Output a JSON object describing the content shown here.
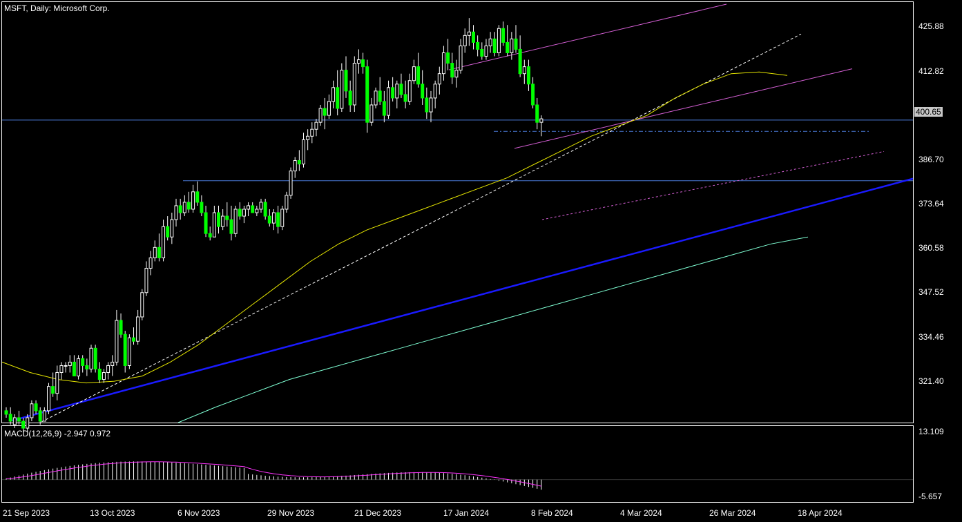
{
  "header": {
    "title": "MSFT, Daily:  Microsoft Corp."
  },
  "macd": {
    "label": "MACD(12,26,9) -2.947 0.972",
    "ymax": "13.109",
    "ymin": "-5.657"
  },
  "price_axis": [
    "425.88",
    "412.82",
    "386.70",
    "373.64",
    "360.58",
    "347.52",
    "334.46",
    "321.40"
  ],
  "current_price": "400.65",
  "date_axis": [
    "21 Sep 2023",
    "13 Oct 2023",
    "6 Nov 2023",
    "29 Nov 2023",
    "21 Dec 2023",
    "17 Jan 2024",
    "8 Feb 2024",
    "4 Mar 2024",
    "26 Mar 2024",
    "18 Apr 2024"
  ],
  "colors": {
    "background": "#000000",
    "bull": "#ffffff",
    "bear": "#00ff00",
    "wick": "#ffffff",
    "ma_short": "#e6e600",
    "ma_long": "#7fffd4",
    "macd_hist": "#ffffff",
    "macd_signal": "#ff33ff",
    "trend_blue": "#1a1aff",
    "channel": "#d45fd4",
    "hline": "#4a7bd9",
    "frame": "#ffffff"
  },
  "chart_data": {
    "type": "candlestick",
    "symbol": "MSFT",
    "timeframe": "Daily",
    "ylim": [
      313.6,
      434.6
    ],
    "last_price": 400.65,
    "candles": [
      [
        317,
        318,
        315,
        316
      ],
      [
        316,
        318,
        313,
        314
      ],
      [
        313,
        316,
        312,
        315
      ],
      [
        315,
        317,
        313,
        314
      ],
      [
        314,
        315,
        311,
        312
      ],
      [
        312,
        316,
        311,
        315
      ],
      [
        315,
        320,
        314,
        319
      ],
      [
        319,
        320,
        316,
        317
      ],
      [
        317,
        318,
        313,
        314
      ],
      [
        314,
        318,
        314,
        317
      ],
      [
        317,
        325,
        316,
        324
      ],
      [
        324,
        328,
        321,
        322
      ],
      [
        322,
        330,
        320,
        328
      ],
      [
        328,
        331,
        326,
        330
      ],
      [
        330,
        331,
        328,
        330
      ],
      [
        330,
        333,
        328,
        331
      ],
      [
        331,
        333,
        327,
        327
      ],
      [
        327,
        333,
        326,
        332
      ],
      [
        332,
        333,
        328,
        330
      ],
      [
        330,
        332,
        327,
        329
      ],
      [
        329,
        336,
        328,
        335
      ],
      [
        335,
        336,
        328,
        329
      ],
      [
        329,
        331,
        325,
        326
      ],
      [
        326,
        329,
        325,
        328
      ],
      [
        328,
        331,
        326,
        330
      ],
      [
        330,
        333,
        327,
        331
      ],
      [
        331,
        346,
        330,
        343
      ],
      [
        343,
        345,
        338,
        339
      ],
      [
        339,
        340,
        328,
        330
      ],
      [
        330,
        339,
        329,
        338
      ],
      [
        338,
        341,
        336,
        337
      ],
      [
        337,
        346,
        336,
        344
      ],
      [
        344,
        352,
        343,
        351
      ],
      [
        351,
        360,
        350,
        358
      ],
      [
        358,
        363,
        356,
        361
      ],
      [
        361,
        366,
        360,
        364
      ],
      [
        364,
        368,
        360,
        361
      ],
      [
        361,
        372,
        360,
        370
      ],
      [
        370,
        373,
        366,
        367
      ],
      [
        367,
        374,
        365,
        372
      ],
      [
        372,
        378,
        370,
        376
      ],
      [
        376,
        378,
        372,
        374
      ],
      [
        374,
        379,
        373,
        377
      ],
      [
        377,
        380,
        374,
        375
      ],
      [
        375,
        382,
        374,
        380
      ],
      [
        380,
        383,
        376,
        377
      ],
      [
        377,
        379,
        373,
        374
      ],
      [
        374,
        376,
        367,
        368
      ],
      [
        368,
        370,
        366,
        367
      ],
      [
        367,
        376,
        367,
        374
      ],
      [
        374,
        376,
        368,
        370
      ],
      [
        370,
        375,
        369,
        373
      ],
      [
        373,
        377,
        370,
        372
      ],
      [
        372,
        376,
        366,
        368
      ],
      [
        368,
        376,
        367,
        375
      ],
      [
        375,
        377,
        372,
        373
      ],
      [
        373,
        376,
        371,
        375
      ],
      [
        375,
        377,
        373,
        376
      ],
      [
        376,
        377,
        374,
        374
      ],
      [
        374,
        376,
        373,
        375
      ],
      [
        375,
        378,
        374,
        377
      ],
      [
        377,
        378,
        372,
        373
      ],
      [
        373,
        375,
        370,
        371
      ],
      [
        371,
        375,
        369,
        374
      ],
      [
        374,
        376,
        368,
        370
      ],
      [
        370,
        376,
        369,
        375
      ],
      [
        375,
        380,
        374,
        379
      ],
      [
        379,
        387,
        378,
        386
      ],
      [
        386,
        390,
        384,
        389
      ],
      [
        389,
        392,
        386,
        388
      ],
      [
        388,
        397,
        387,
        395
      ],
      [
        395,
        398,
        392,
        396
      ],
      [
        396,
        400,
        394,
        398
      ],
      [
        398,
        401,
        396,
        400
      ],
      [
        400,
        405,
        399,
        404
      ],
      [
        404,
        407,
        398,
        402
      ],
      [
        402,
        408,
        401,
        406
      ],
      [
        406,
        412,
        404,
        410
      ],
      [
        410,
        415,
        402,
        404
      ],
      [
        404,
        417,
        403,
        415
      ],
      [
        415,
        419,
        407,
        409
      ],
      [
        409,
        412,
        403,
        405
      ],
      [
        405,
        419,
        403,
        417
      ],
      [
        417,
        421,
        414,
        418
      ],
      [
        418,
        420,
        414,
        416
      ],
      [
        416,
        418,
        397,
        400
      ],
      [
        400,
        407,
        399,
        405
      ],
      [
        405,
        410,
        404,
        409
      ],
      [
        409,
        413,
        405,
        406
      ],
      [
        406,
        409,
        400,
        402
      ],
      [
        402,
        412,
        401,
        410
      ],
      [
        410,
        413,
        406,
        407
      ],
      [
        407,
        412,
        404,
        411
      ],
      [
        411,
        414,
        407,
        408
      ],
      [
        408,
        412,
        404,
        406
      ],
      [
        406,
        414,
        405,
        412
      ],
      [
        412,
        418,
        411,
        416
      ],
      [
        416,
        420,
        410,
        411
      ],
      [
        411,
        415,
        405,
        407
      ],
      [
        407,
        410,
        401,
        403
      ],
      [
        403,
        409,
        400,
        407
      ],
      [
        407,
        412,
        404,
        411
      ],
      [
        411,
        416,
        408,
        414
      ],
      [
        414,
        422,
        412,
        420
      ],
      [
        420,
        424,
        415,
        417
      ],
      [
        417,
        420,
        411,
        413
      ],
      [
        413,
        418,
        410,
        415
      ],
      [
        415,
        424,
        414,
        422
      ],
      [
        422,
        427,
        420,
        425
      ],
      [
        425,
        430,
        422,
        426
      ],
      [
        426,
        428,
        421,
        423
      ],
      [
        423,
        425,
        419,
        421
      ],
      [
        421,
        423,
        418,
        419
      ],
      [
        419,
        424,
        418,
        422
      ],
      [
        422,
        426,
        420,
        424
      ],
      [
        424,
        426,
        419,
        420
      ],
      [
        420,
        428,
        419,
        427
      ],
      [
        427,
        429,
        422,
        423
      ],
      [
        423,
        428,
        419,
        420
      ],
      [
        420,
        426,
        418,
        424
      ],
      [
        424,
        428,
        420,
        421
      ],
      [
        421,
        425,
        413,
        414
      ],
      [
        414,
        418,
        411,
        416
      ],
      [
        416,
        418,
        409,
        411
      ],
      [
        411,
        413,
        404,
        405
      ],
      [
        405,
        407,
        398,
        400
      ],
      [
        400,
        402,
        396,
        401
      ]
    ],
    "indicators": [
      {
        "type": "moving_average",
        "color": "ma_short"
      },
      {
        "type": "moving_average",
        "color": "ma_long"
      }
    ]
  }
}
